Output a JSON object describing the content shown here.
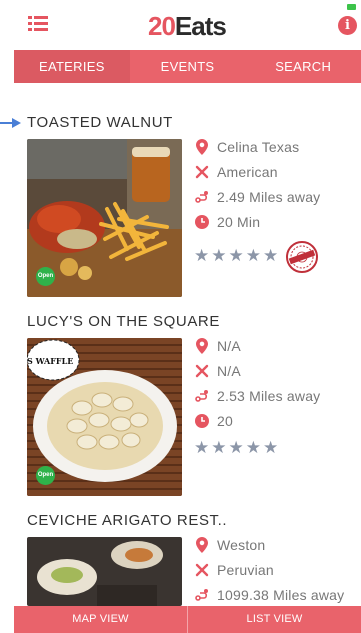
{
  "header": {
    "logo_number": "20",
    "logo_text": "Eats"
  },
  "tabs": [
    {
      "label": "EATERIES",
      "active": true
    },
    {
      "label": "EVENTS",
      "active": false
    },
    {
      "label": "SEARCH",
      "active": false
    }
  ],
  "restaurants": [
    {
      "name": "TOASTED WALNUT",
      "location": "Celina Texas",
      "cuisine": "American",
      "distance": "2.49 Miles away",
      "time": "20 Min",
      "rating": 0,
      "open_label": "Open",
      "has_special_badge": true
    },
    {
      "name": "LUCY'S ON THE SQUARE",
      "location": "N/A",
      "cuisine": "N/A",
      "distance": "2.53 Miles away",
      "time": "20",
      "rating": 0,
      "open_label": "Open",
      "photo_sign": "S WAFFLE"
    },
    {
      "name": "CEVICHE ARIGATO REST..",
      "location": "Weston",
      "cuisine": "Peruvian",
      "distance": "1099.38 Miles away"
    }
  ],
  "bottom_bar": {
    "map_view": "MAP VIEW",
    "list_view": "LIST VIEW"
  },
  "colors": {
    "brand": "#e9636b",
    "text": "#777777",
    "star": "#8c96a8",
    "open": "#2fb24a"
  },
  "icons": {
    "location": "map-pin-icon",
    "cuisine": "crossed-utensils-icon",
    "distance": "route-icon",
    "time": "clock-icon"
  }
}
